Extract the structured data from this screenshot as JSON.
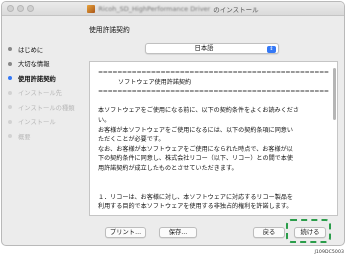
{
  "window": {
    "title_blurred": "Ricoh_SD_HighPerformance Driver",
    "title_suffix": "のインストール"
  },
  "sidebar": {
    "steps": [
      {
        "label": "はじめに",
        "state": "done"
      },
      {
        "label": "大切な情報",
        "state": "done"
      },
      {
        "label": "使用許諾契約",
        "state": "current"
      },
      {
        "label": "インストール先",
        "state": "inactive"
      },
      {
        "label": "インストールの種類",
        "state": "inactive"
      },
      {
        "label": "インストール",
        "state": "inactive"
      },
      {
        "label": "概要",
        "state": "inactive"
      }
    ]
  },
  "main": {
    "pane_title": "使用許諾契約",
    "language_select": {
      "value": "日本語"
    },
    "license": {
      "separator": "================================================",
      "heading": "ソフトウェア使用許諾契約",
      "lines": [
        "本ソフトウェアをご使用になる前に、以下の契約条件をよくお読みくださ",
        "い。",
        "お客様が本ソフトウェアをご使用になるには、以下の契約条項に同意い",
        "ただくことが必要です。",
        "なお、お客様が本ソフトウェアをご使用になられた時点で、お客様が以",
        "下の契約条件に同意し、株式会社リコー（以下、リコー）との間で本使",
        "用許諾契約が成立したものとさせていただきます。"
      ],
      "clause_lines": [
        "１．リコーは、お客様に対し、本ソフトウェアに対応するリコー製品を",
        "利用する目的で本ソフトウェアを使用する非独占的権利を許諾します。"
      ]
    }
  },
  "footer": {
    "print_label": "プリント...",
    "save_label": "保存...",
    "back_label": "戻る",
    "continue_label": "続ける"
  },
  "figure_id": "J109DC5003",
  "colors": {
    "accent": "#3478f6",
    "highlight": "#2a9d4a"
  }
}
